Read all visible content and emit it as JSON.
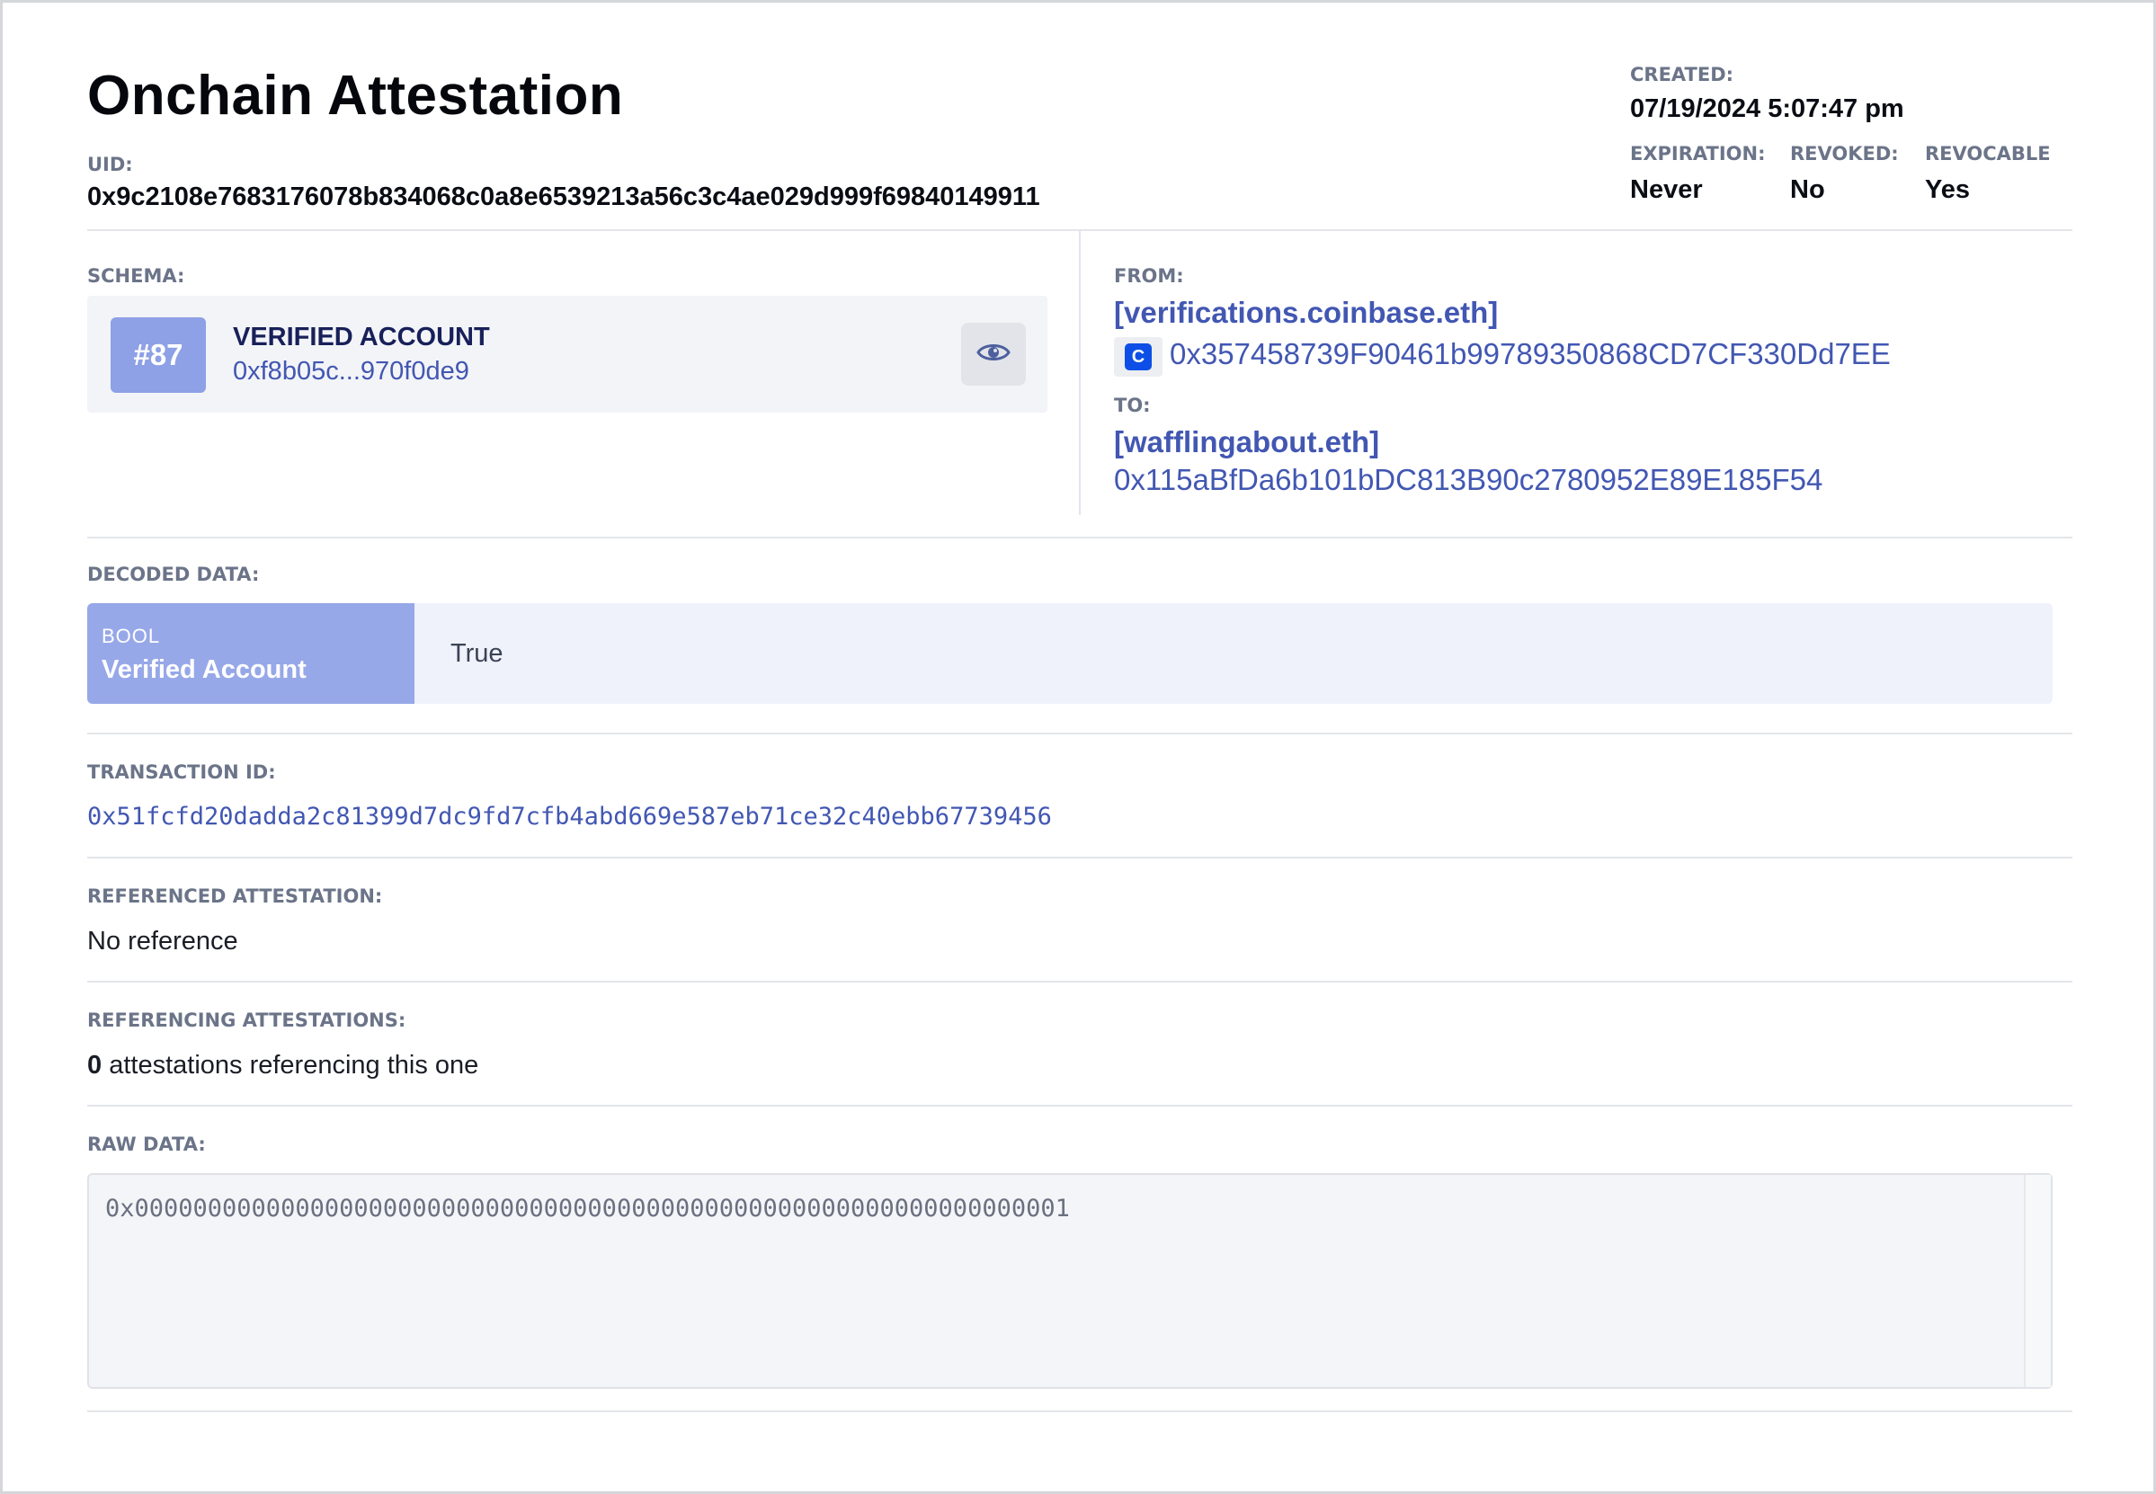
{
  "header": {
    "title": "Onchain Attestation",
    "uid_label": "UID:",
    "uid": "0x9c2108e7683176078b834068c0a8e6539213a56c3c4ae029d999f69840149911",
    "created_label": "CREATED:",
    "created": "07/19/2024 5:07:47 pm",
    "expiration_label": "EXPIRATION:",
    "expiration": "Never",
    "revoked_label": "REVOKED:",
    "revoked": "No",
    "revocable_label": "REVOCABLE",
    "revocable": "Yes"
  },
  "schema": {
    "label": "SCHEMA:",
    "badge": "#87",
    "name": "VERIFIED ACCOUNT",
    "hash": "0xf8b05c...970f0de9",
    "icon": "eye-icon"
  },
  "from": {
    "label": "FROM:",
    "ens": "[verifications.coinbase.eth]",
    "icon": "coinbase-icon",
    "address": "0x357458739F90461b99789350868CD7CF330Dd7EE"
  },
  "to": {
    "label": "TO:",
    "ens": "[wafflingabout.eth]",
    "address": "0x115aBfDa6b101bDC813B90c2780952E89E185F54"
  },
  "decoded": {
    "label": "DECODED DATA:",
    "type": "BOOL",
    "name": "Verified Account",
    "value": "True"
  },
  "transaction": {
    "label": "TRANSACTION ID:",
    "id": "0x51fcfd20dadda2c81399d7dc9fd7cfb4abd669e587eb71ce32c40ebb67739456"
  },
  "referenced": {
    "label": "REFERENCED ATTESTATION:",
    "value": "No reference"
  },
  "referencing": {
    "label": "REFERENCING ATTESTATIONS:",
    "count": "0",
    "text": "attestations referencing this one"
  },
  "raw": {
    "label": "RAW DATA:",
    "value": "0x0000000000000000000000000000000000000000000000000000000000000001"
  },
  "colors": {
    "accent": "#4257b2",
    "badge": "#8ea0e6",
    "decoded_key_bg": "#97a8e8",
    "coinbase_blue": "#0d4fe6"
  }
}
